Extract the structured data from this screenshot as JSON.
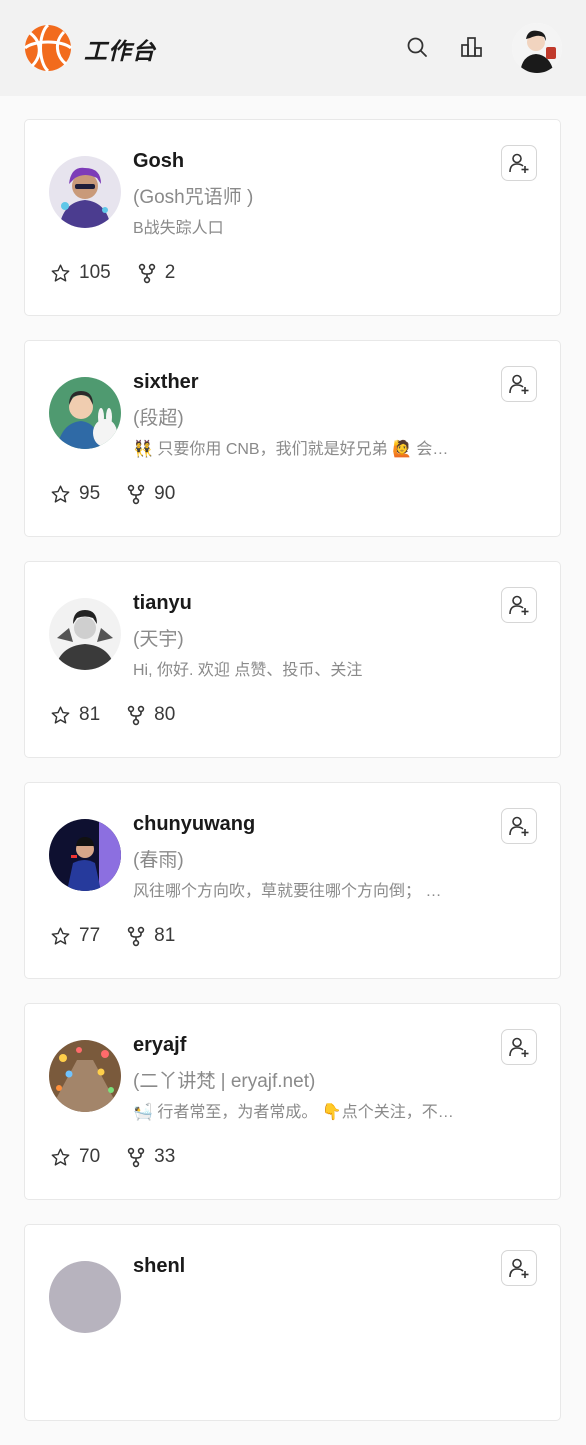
{
  "header": {
    "title": "工作台",
    "logo_icon": "basketball-logo-icon",
    "accent": "#f26b1d"
  },
  "users": [
    {
      "name": "Gosh",
      "nick": "(Gosh咒语师 )",
      "bio": "B战失踪人口",
      "stars": "105",
      "forks": "2",
      "avatar_bg": "#6b4fb3"
    },
    {
      "name": "sixther",
      "nick": "(段超)",
      "bio": "👯 只要你用 CNB，我们就是好兄弟 🙋 会…",
      "stars": "95",
      "forks": "90",
      "avatar_bg": "#3f8a5e"
    },
    {
      "name": "tianyu",
      "nick": "(天宇)",
      "bio": "Hi, 你好. 欢迎 点赞、投币、关注",
      "stars": "81",
      "forks": "80",
      "avatar_bg": "#9a9a9a"
    },
    {
      "name": "chunyuwang",
      "nick": "(春雨)",
      "bio": "风往哪个方向吹，草就要往哪个方向倒； …",
      "stars": "77",
      "forks": "81",
      "avatar_bg": "#1b1f5e"
    },
    {
      "name": "eryajf",
      "nick": "(二丫讲梵 | eryajf.net)",
      "bio": "🛀 行者常至，为者常成。 👇点个关注，不…",
      "stars": "70",
      "forks": "33",
      "avatar_bg": "#8a6a4a"
    },
    {
      "name": "shenl",
      "nick": "",
      "bio": "",
      "stars": "",
      "forks": "",
      "avatar_bg": "#b7b3be"
    }
  ]
}
